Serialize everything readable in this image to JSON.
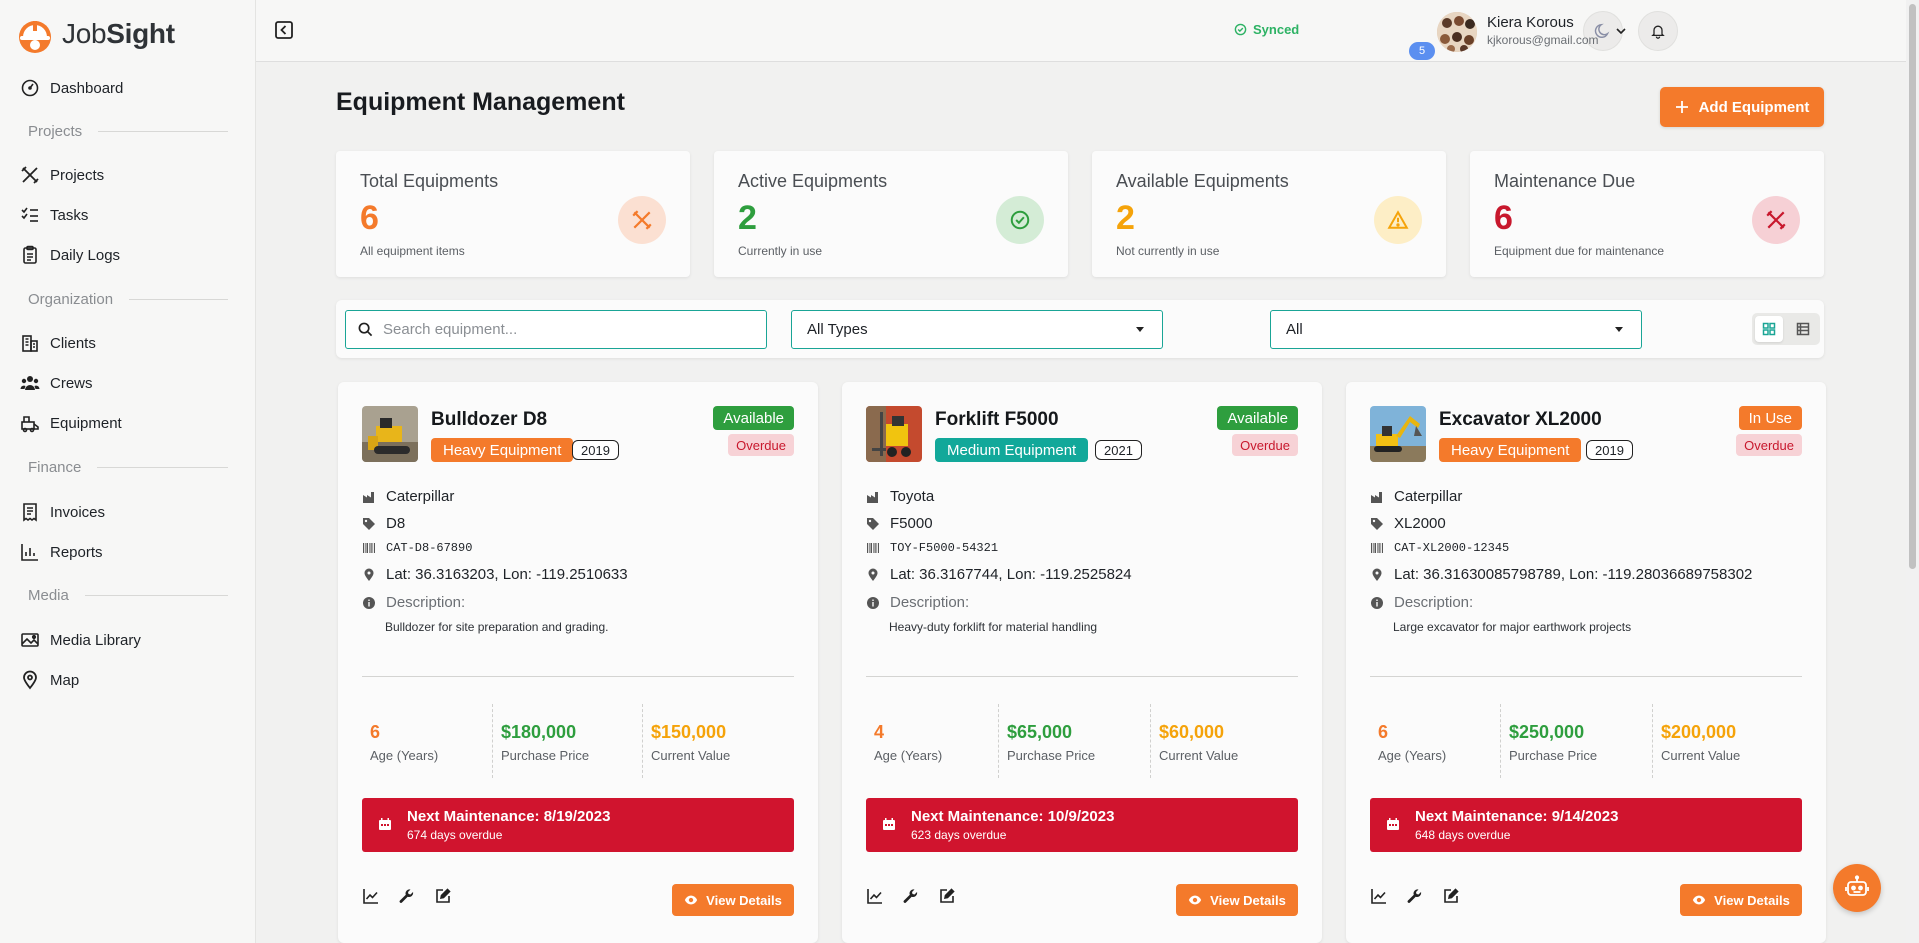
{
  "app": {
    "name_light": "Job",
    "name_bold": "Sight"
  },
  "sidebar": {
    "dashboard": "Dashboard",
    "section_projects": "Projects",
    "projects": "Projects",
    "tasks": "Tasks",
    "daily_logs": "Daily Logs",
    "section_organization": "Organization",
    "clients": "Clients",
    "crews": "Crews",
    "equipment": "Equipment",
    "section_finance": "Finance",
    "invoices": "Invoices",
    "reports": "Reports",
    "section_media": "Media",
    "media_library": "Media Library",
    "map": "Map"
  },
  "topbar": {
    "sync_status": "Synced",
    "notification_count": "5",
    "user_name": "Kiera Korous",
    "user_email": "kjkorous@gmail.com"
  },
  "page": {
    "title": "Equipment Management",
    "add_button": "Add Equipment"
  },
  "stats": [
    {
      "label": "Total Equipments",
      "value": "6",
      "sub": "All equipment items",
      "color": "#f47a2b"
    },
    {
      "label": "Active Equipments",
      "value": "2",
      "sub": "Currently in use",
      "color": "#2e9e3e"
    },
    {
      "label": "Available Equipments",
      "value": "2",
      "sub": "Not currently in use",
      "color": "#f5a30a"
    },
    {
      "label": "Maintenance Due",
      "value": "6",
      "sub": "Equipment due for maintenance",
      "color": "#c8182d"
    }
  ],
  "filters": {
    "search_placeholder": "Search equipment...",
    "type_select": "All Types",
    "status_select": "All"
  },
  "labels": {
    "description": "Description:",
    "age": "Age (Years)",
    "purchase": "Purchase Price",
    "current": "Current Value",
    "view_details": "View Details"
  },
  "equipment": [
    {
      "name": "Bulldozer D8",
      "type": "Heavy Equipment",
      "type_color": "#f47a2b",
      "year": "2019",
      "status": "Available",
      "status_color": "#2e9e3e",
      "overdue": "Overdue",
      "manufacturer": "Caterpillar",
      "model": "D8",
      "serial": "CAT-D8-67890",
      "location": "Lat: 36.3163203, Lon: -119.2510633",
      "description": "Bulldozer for site preparation and grading.",
      "age": "6",
      "purchase_price": "$180,000",
      "current_value": "$150,000",
      "maintenance": "Next Maintenance: 8/19/2023",
      "overdue_days": "674 days overdue"
    },
    {
      "name": "Forklift F5000",
      "type": "Medium Equipment",
      "type_color": "#12a89a",
      "year": "2021",
      "status": "Available",
      "status_color": "#2e9e3e",
      "overdue": "Overdue",
      "manufacturer": "Toyota",
      "model": "F5000",
      "serial": "TOY-F5000-54321",
      "location": "Lat: 36.3167744, Lon: -119.2525824",
      "description": "Heavy-duty forklift for material handling",
      "age": "4",
      "purchase_price": "$65,000",
      "current_value": "$60,000",
      "maintenance": "Next Maintenance: 10/9/2023",
      "overdue_days": "623 days overdue"
    },
    {
      "name": "Excavator XL2000",
      "type": "Heavy Equipment",
      "type_color": "#f47a2b",
      "year": "2019",
      "status": "In Use",
      "status_color": "#f47a2b",
      "overdue": "Overdue",
      "manufacturer": "Caterpillar",
      "model": "XL2000",
      "serial": "CAT-XL2000-12345",
      "location": "Lat: 36.31630085798789, Lon: -119.28036689758302",
      "description": "Large excavator for major earthwork projects",
      "age": "6",
      "purchase_price": "$250,000",
      "current_value": "$200,000",
      "maintenance": "Next Maintenance: 9/14/2023",
      "overdue_days": "648 days overdue"
    }
  ]
}
